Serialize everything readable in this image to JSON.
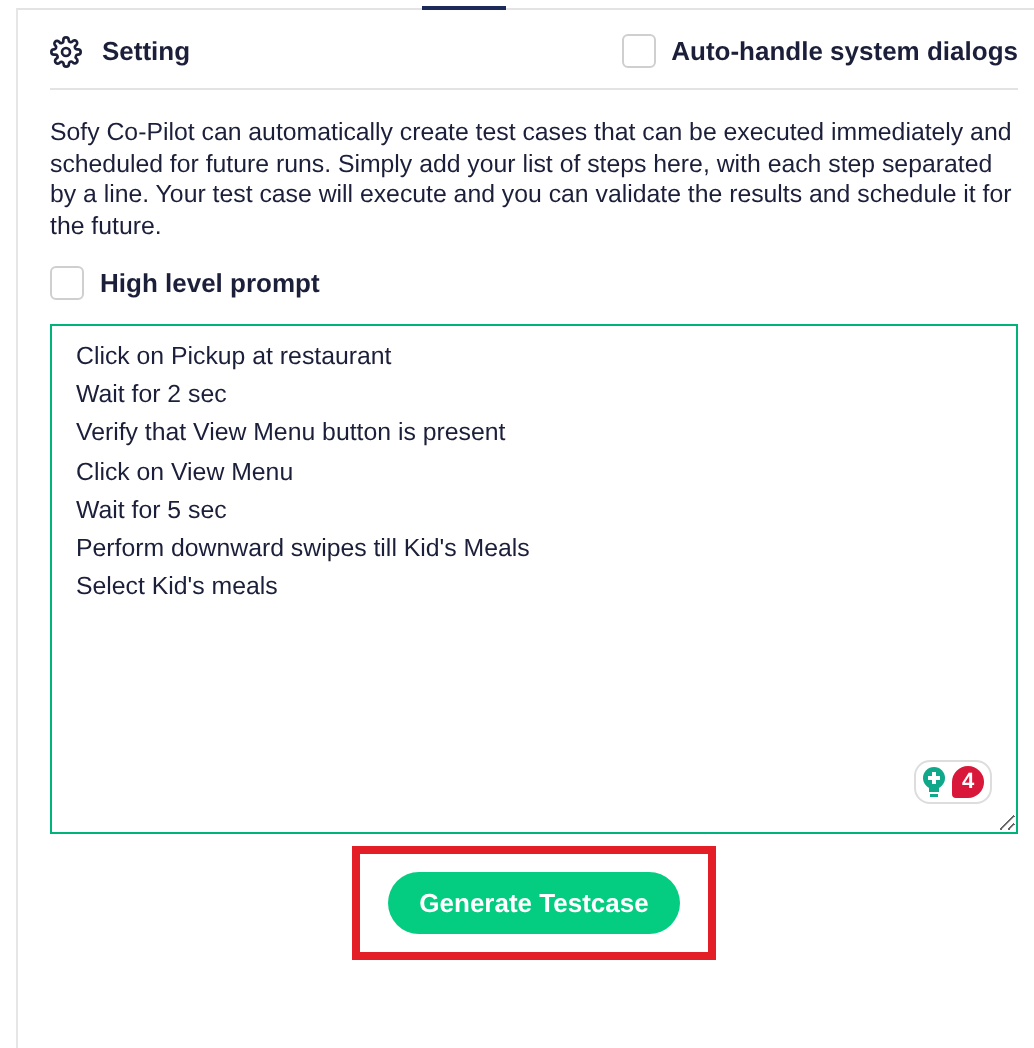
{
  "header": {
    "title": "Setting",
    "auto_handle": {
      "label": "Auto-handle system dialogs",
      "checked": false
    }
  },
  "description": "Sofy Co-Pilot can automatically create test cases that can be executed immediately and scheduled for future runs. Simply add your list of steps here, with each step separated by a line. Your test case will execute and you can validate the results and schedule it for the future.",
  "high_level_prompt": {
    "label": "High level prompt",
    "checked": false
  },
  "steps": [
    "Click on Pickup at restaurant",
    "Wait for 2 sec",
    "Verify that View Menu button is present",
    "Click on View Menu",
    "Wait for 5 sec",
    "Perform downward swipes till Kid's Meals",
    "Select Kid's meals"
  ],
  "assistant_badge": {
    "count": "4"
  },
  "generate_button": {
    "label": "Generate Testcase",
    "highlighted": true
  }
}
